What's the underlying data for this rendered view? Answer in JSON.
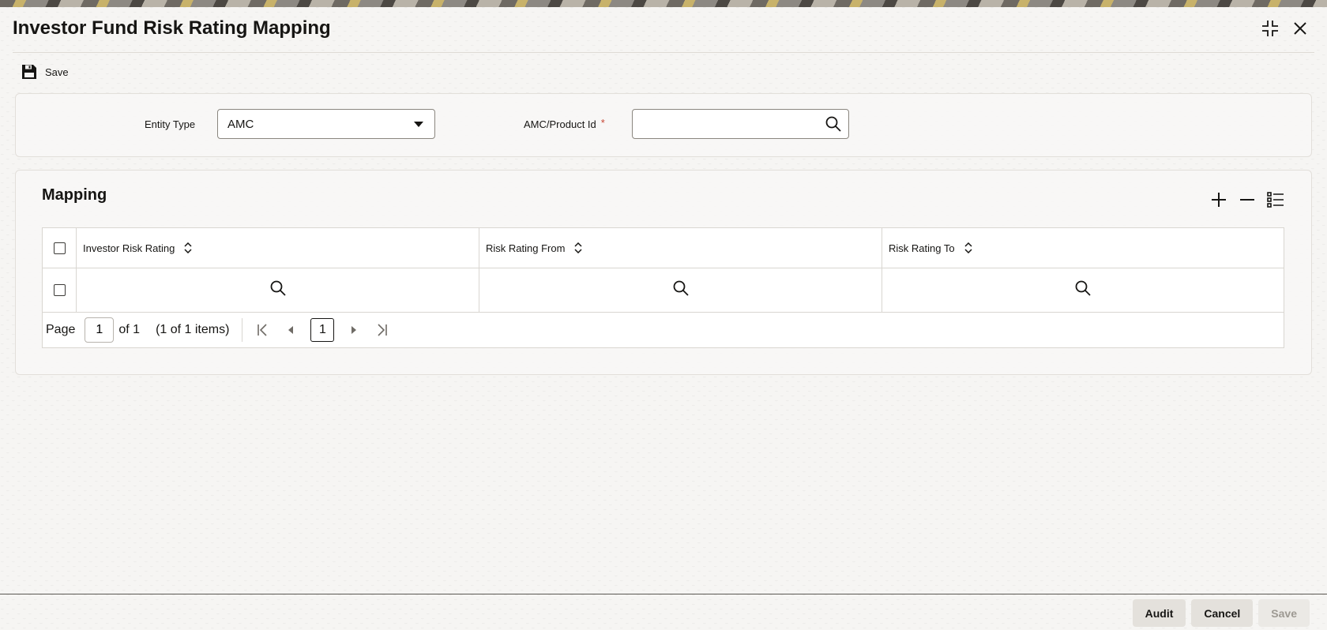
{
  "window": {
    "title": "Investor Fund Risk Rating Mapping"
  },
  "toolbar": {
    "save_label": "Save"
  },
  "criteria": {
    "entity_type_label": "Entity Type",
    "entity_type_value": "AMC",
    "product_id_label": "AMC/Product Id",
    "required_mark": "*",
    "product_id_value": ""
  },
  "mapping": {
    "title": "Mapping",
    "columns": [
      {
        "label": "Investor Risk Rating"
      },
      {
        "label": "Risk Rating From"
      },
      {
        "label": "Risk Rating To"
      }
    ],
    "pager": {
      "page_label": "Page",
      "page_value": "1",
      "of_label": "of 1",
      "items_label": "(1 of 1 items)",
      "current_page": "1"
    }
  },
  "footer": {
    "audit_label": "Audit",
    "cancel_label": "Cancel",
    "save_label": "Save"
  },
  "colors": {
    "background": "#f6f5f3",
    "required": "#c74634",
    "border": "#d9d6d1"
  }
}
